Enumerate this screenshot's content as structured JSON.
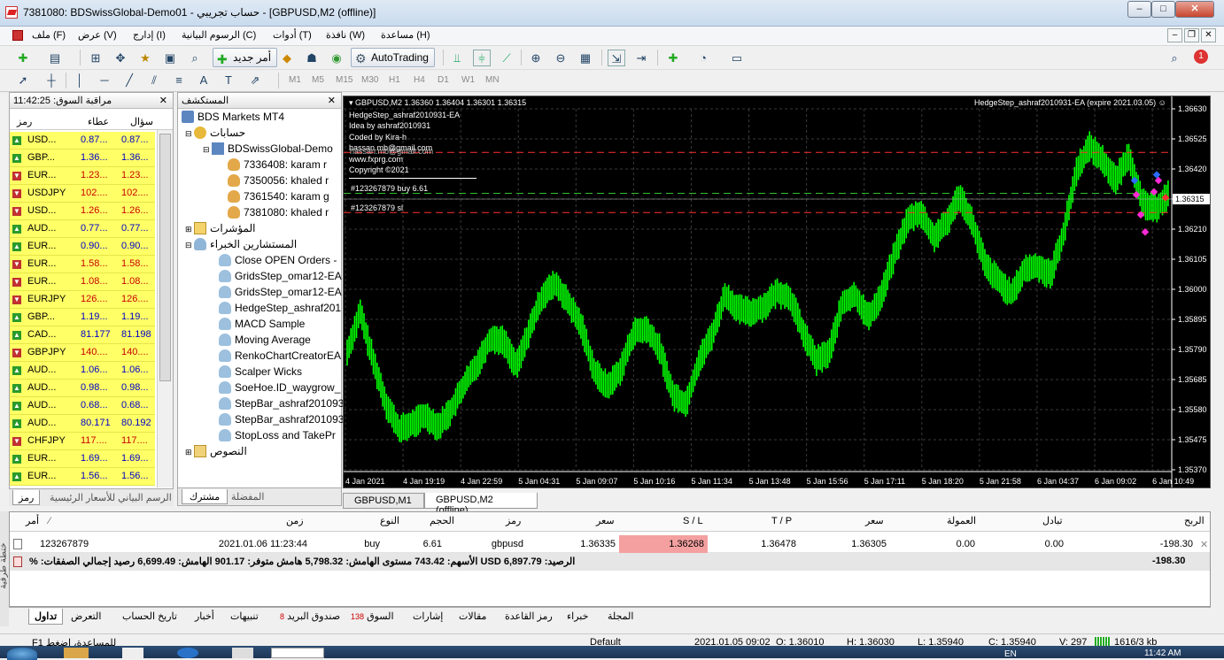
{
  "window": {
    "title": "7381080: BDSwissGlobal-Demo01 - حساب تجريبي - [GBPUSD,M2 (offline)]",
    "min": "–",
    "max": "□",
    "close": "✕"
  },
  "menu": [
    {
      "label": "ملف (F)"
    },
    {
      "label": "عرض (V)"
    },
    {
      "label": "إدارج (I)"
    },
    {
      "label": "الرسوم البيانية (C)"
    },
    {
      "label": "أدوات (T)"
    },
    {
      "label": "نافذة (W)"
    },
    {
      "label": "مساعدة (H)"
    }
  ],
  "toolbar": {
    "new_order": "أمر جديد",
    "autotrading": "AutoTrading",
    "timeframes": [
      "M1",
      "M5",
      "M15",
      "M30",
      "H1",
      "H4",
      "D1",
      "W1",
      "MN"
    ]
  },
  "market_watch": {
    "title": "مراقبة السوق: 11:42:25",
    "col_symbol": "رمز",
    "col_bid": "عطاء",
    "col_ask": "سؤال",
    "rows": [
      {
        "symbol": "USD...",
        "bid": "0.87...",
        "ask": "0.87...",
        "dir": "up"
      },
      {
        "symbol": "GBP...",
        "bid": "1.36...",
        "ask": "1.36...",
        "dir": "up"
      },
      {
        "symbol": "EUR...",
        "bid": "1.23...",
        "ask": "1.23...",
        "dir": "down"
      },
      {
        "symbol": "USDJPY",
        "bid": "102....",
        "ask": "102....",
        "dir": "down"
      },
      {
        "symbol": "USD...",
        "bid": "1.26...",
        "ask": "1.26...",
        "dir": "down"
      },
      {
        "symbol": "AUD...",
        "bid": "0.77...",
        "ask": "0.77...",
        "dir": "up"
      },
      {
        "symbol": "EUR...",
        "bid": "0.90...",
        "ask": "0.90...",
        "dir": "up"
      },
      {
        "symbol": "EUR...",
        "bid": "1.58...",
        "ask": "1.58...",
        "dir": "down"
      },
      {
        "symbol": "EUR...",
        "bid": "1.08...",
        "ask": "1.08...",
        "dir": "down"
      },
      {
        "symbol": "EURJPY",
        "bid": "126....",
        "ask": "126....",
        "dir": "down"
      },
      {
        "symbol": "GBP...",
        "bid": "1.19...",
        "ask": "1.19...",
        "dir": "up"
      },
      {
        "symbol": "CAD...",
        "bid": "81.177",
        "ask": "81.198",
        "dir": "up"
      },
      {
        "symbol": "GBPJPY",
        "bid": "140....",
        "ask": "140....",
        "dir": "down"
      },
      {
        "symbol": "AUD...",
        "bid": "1.06...",
        "ask": "1.06...",
        "dir": "up"
      },
      {
        "symbol": "AUD...",
        "bid": "0.98...",
        "ask": "0.98...",
        "dir": "up"
      },
      {
        "symbol": "AUD...",
        "bid": "0.68...",
        "ask": "0.68...",
        "dir": "up"
      },
      {
        "symbol": "AUD...",
        "bid": "80.171",
        "ask": "80.192",
        "dir": "up"
      },
      {
        "symbol": "CHFJPY",
        "bid": "117....",
        "ask": "117....",
        "dir": "down"
      },
      {
        "symbol": "EUR...",
        "bid": "1.69...",
        "ask": "1.69...",
        "dir": "up"
      },
      {
        "symbol": "EUR...",
        "bid": "1.56...",
        "ask": "1.56...",
        "dir": "up"
      }
    ],
    "tab_symbols": "رمز",
    "tab_chart": "الرسم البياني للأسعار الرئيسية"
  },
  "navigator": {
    "title": "المستكشف",
    "root": "BDS Markets MT4",
    "accounts": "حسابات",
    "server": "BDSwissGlobal-Demo",
    "account_list": [
      "7336408: karam r",
      "7350056: khaled r",
      "7361540: karam g",
      "7381080: khaled r"
    ],
    "indicators": "المؤشرات",
    "experts": "المستشارين الخبراء",
    "expert_list": [
      "Close OPEN Orders -",
      "GridsStep_omar12-EA",
      "GridsStep_omar12-EA",
      "HedgeStep_ashraf201",
      "MACD Sample",
      "Moving Average",
      "RenkoChartCreatorEA",
      "Scalper Wicks",
      "SoeHoe.ID_waygrow_",
      "StepBar_ashraf201093",
      "StepBar_ashraf201093",
      "StopLoss and TakePr"
    ],
    "scripts": "النصوص",
    "tab_common": "مشترك",
    "tab_favorites": "المفضلة"
  },
  "chart": {
    "header": "GBPUSD,M2  1.36360 1.36404 1.36301 1.36315",
    "ea_label": "HedgeStep_ashraf2010931-EA (expire 2021.03.05)",
    "info": [
      "HedgeStep_ashraf2010931-EA",
      "Idea by ashraf2010931",
      "Coded by Kira-h",
      "hassan.mb@gmail.com",
      "www.fxprg.com",
      "Copyright ©2021"
    ],
    "info_overlap": "hassan.mb@gmail.com",
    "order_buy": "#123267879 buy 6.61",
    "order_sl": "#123267879 sl",
    "tabs": [
      "GBPUSD,M1",
      "GBPUSD,M2 (offline)"
    ],
    "bull_color": "#00ff00",
    "grid_color": "#3a3a3a"
  },
  "chart_data": {
    "type": "candlestick",
    "symbol": "GBPUSD",
    "timeframe": "M2",
    "ylim": [
      1.3537,
      1.3663
    ],
    "yticks": [
      "1.36630",
      "1.36525",
      "1.36420",
      "1.36315",
      "1.36210",
      "1.36105",
      "1.36000",
      "1.35895",
      "1.35790",
      "1.35685",
      "1.35580",
      "1.35475",
      "1.35370"
    ],
    "xticks": [
      "4 Jan 2021",
      "4 Jan 19:19",
      "4 Jan 22:59",
      "5 Jan 04:31",
      "5 Jan 09:07",
      "5 Jan 10:16",
      "5 Jan 11:34",
      "5 Jan 13:48",
      "5 Jan 15:56",
      "5 Jan 17:11",
      "5 Jan 18:20",
      "5 Jan 21:58",
      "6 Jan 04:37",
      "6 Jan 09:02",
      "6 Jan 10:49"
    ],
    "current_price": "1.36315",
    "close_path": [
      1.3578,
      1.3592,
      1.3575,
      1.356,
      1.3551,
      1.3553,
      1.3556,
      1.3552,
      1.3558,
      1.3567,
      1.3574,
      1.3583,
      1.3582,
      1.3573,
      1.3586,
      1.3598,
      1.3602,
      1.3595,
      1.3587,
      1.3571,
      1.3566,
      1.3572,
      1.3585,
      1.3586,
      1.3579,
      1.3563,
      1.356,
      1.3575,
      1.3584,
      1.3598,
      1.3593,
      1.3592,
      1.3594,
      1.3599,
      1.3597,
      1.3585,
      1.3575,
      1.3578,
      1.3595,
      1.3598,
      1.359,
      1.3598,
      1.3612,
      1.3624,
      1.3627,
      1.3618,
      1.3623,
      1.3633,
      1.3623,
      1.3608,
      1.3603,
      1.3598,
      1.3607,
      1.3608,
      1.3605,
      1.362,
      1.3642,
      1.365,
      1.3645,
      1.3638,
      1.3647,
      1.363,
      1.3628,
      1.3633
    ]
  },
  "terminal": {
    "cols": {
      "order": "أمر",
      "time": "زمن",
      "type": "النوع",
      "size": "الحجم",
      "symbol": "رمز",
      "price": "سعر",
      "sl": "S / L",
      "tp": "T / P",
      "price2": "سعر",
      "commission": "العمولة",
      "swap": "تبادل",
      "profit": "الربح"
    },
    "row": {
      "order": "123267879",
      "time": "2021.01.06 11:23:44",
      "type": "buy",
      "size": "6.61",
      "symbol": "gbpusd",
      "price": "1.36335",
      "sl": "1.36268",
      "tp": "1.36478",
      "price2": "1.36305",
      "commission": "0.00",
      "swap": "0.00",
      "profit": "-198.30"
    },
    "summary": "الرصيد: 6,897.79 USD  الأسهم: 743.42  مستوى الهامش: 5,798.32  هامش متوفر: 901.17  الهامش: 6,699.49  رصيد إجمالي الصفقات: %",
    "summary_profit": "-198.30",
    "tabs": [
      "تداول",
      "التعرض",
      "تاريخ الحساب",
      "أخبار",
      "تنبيهات",
      "صندوق البريد",
      "السوق",
      "إشارات",
      "مقالات",
      "رمز القاعدة",
      "خبراء",
      "المجلة"
    ],
    "mailbox_badge": "8",
    "market_badge": "138",
    "side_label": "ختطة طرفية"
  },
  "status": {
    "help": "F1 للمساعدة، اضغط",
    "profile": "Default",
    "time": "2021.01.05 09:02",
    "open": "O: 1.36010",
    "high": "H: 1.36030",
    "low": "L: 1.35940",
    "close": "C: 1.35940",
    "volume": "V: 297",
    "traffic": "1616/3 kb"
  },
  "taskbar": {
    "lang": "EN",
    "clock": "11:42 AM"
  }
}
